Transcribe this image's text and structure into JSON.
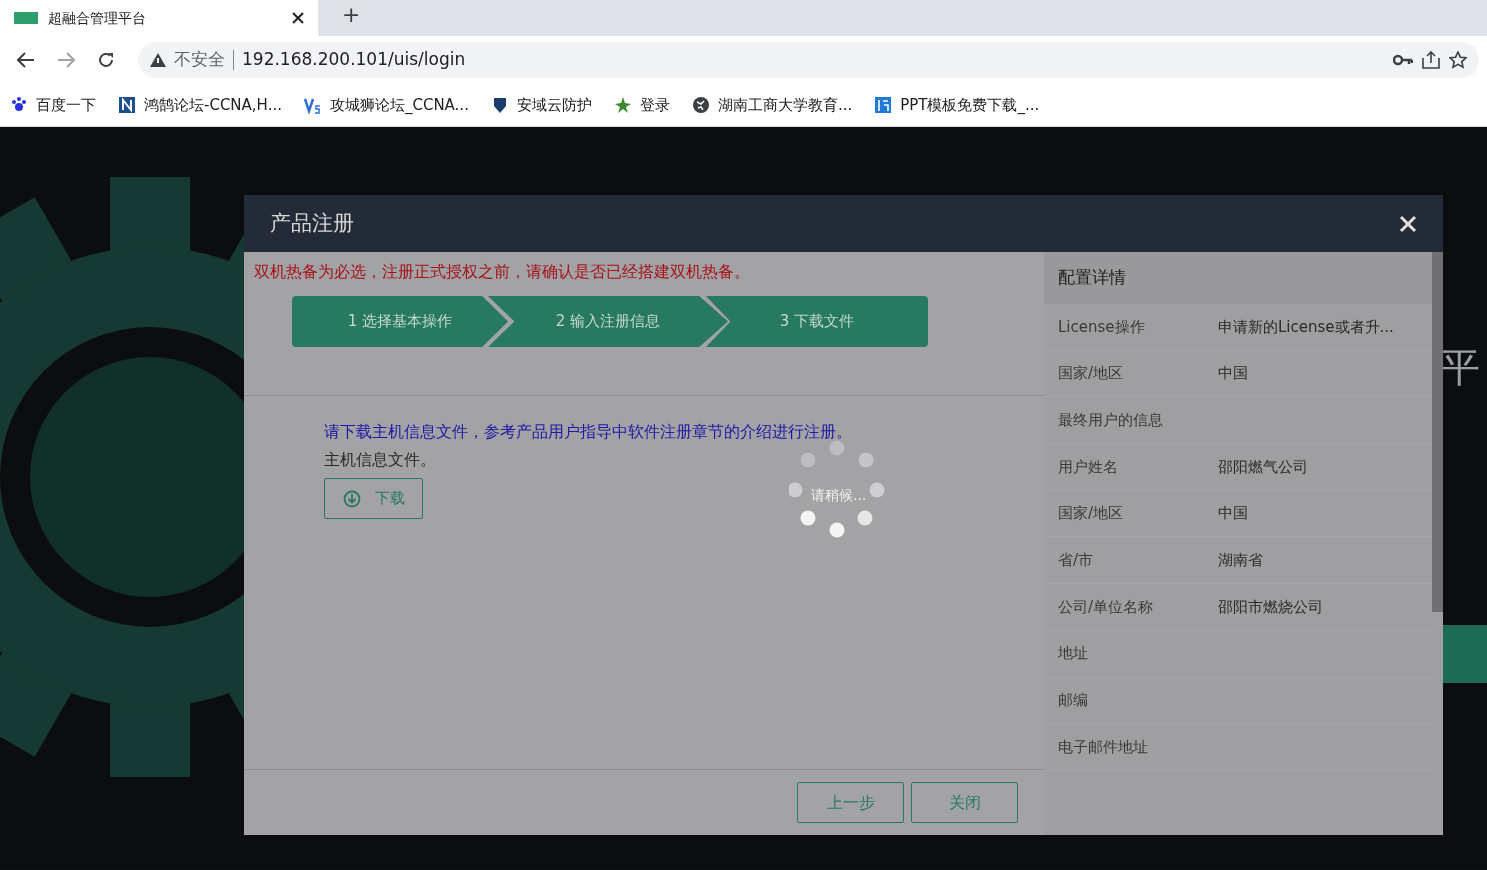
{
  "browser": {
    "tab": {
      "title": "超融合管理平台"
    },
    "new_tab": "+",
    "address": {
      "security": "不安全",
      "url": "192.168.200.101/uis/login"
    },
    "bookmarks": [
      {
        "label": "百度一下"
      },
      {
        "label": "鸿鹄论坛-CCNA,H..."
      },
      {
        "label": "攻城狮论坛_CCNA..."
      },
      {
        "label": "安域云防护"
      },
      {
        "label": "登录"
      },
      {
        "label": "湖南工商大学教育..."
      },
      {
        "label": "PPT模板免费下载_..."
      }
    ]
  },
  "page": {
    "background_title": "平"
  },
  "dialog": {
    "title": "产品注册",
    "warning": "双机热备为必选，注册正式授权之前，请确认是否已经搭建双机热备。",
    "steps": [
      {
        "label": "1 选择基本操作"
      },
      {
        "label": "2 输入注册信息"
      },
      {
        "label": "3 下载文件"
      }
    ],
    "instruction": "请下载主机信息文件，参考产品用户指导中软件注册章节的介绍进行注册。",
    "file_label": "主机信息文件。",
    "download_button": "下载",
    "loading": "请稍候...",
    "buttons": [
      "上一步",
      "关闭"
    ],
    "details": {
      "title": "配置详情",
      "rows": [
        {
          "label": "License操作",
          "value": "申请新的License或者升..."
        },
        {
          "label": "国家/地区",
          "value": "中国"
        },
        {
          "label": "最终用户的信息"
        },
        {
          "label": "用户姓名",
          "value": "邵阳燃气公司"
        },
        {
          "label": "国家/地区",
          "value": "中国"
        },
        {
          "label": "省/市",
          "value": "湖南省"
        },
        {
          "label": "公司/单位名称",
          "value": "邵阳市燃烧公司"
        },
        {
          "label": "地址"
        },
        {
          "label": "邮编"
        },
        {
          "label": "电子邮件地址"
        }
      ]
    }
  }
}
